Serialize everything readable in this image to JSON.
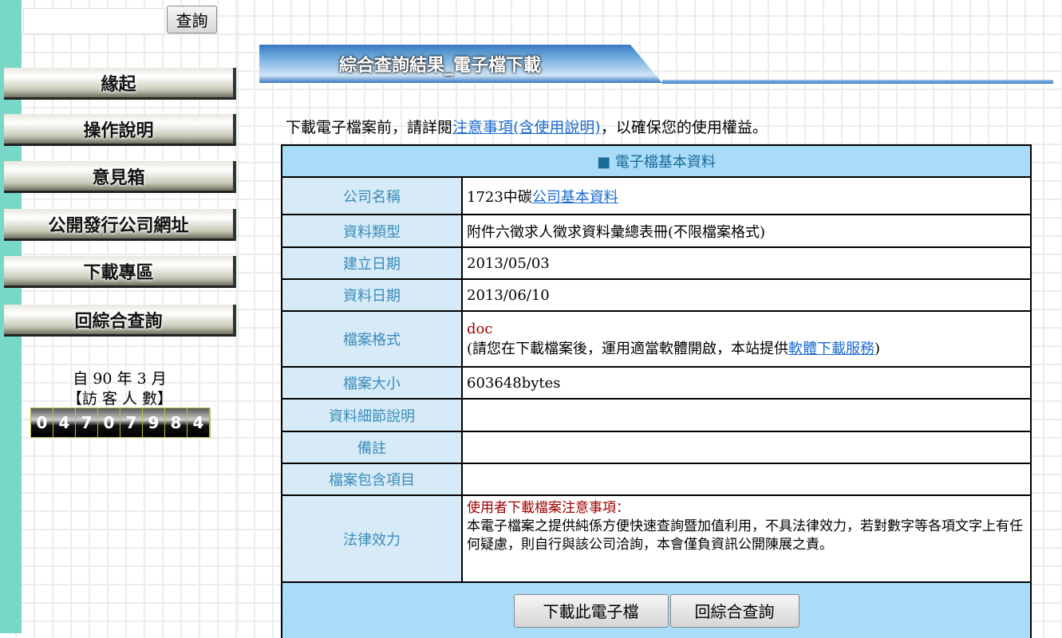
{
  "sidebar": {
    "search_button": "查詢",
    "nav": [
      "緣起",
      "操作說明",
      "意見箱",
      "公開發行公司網址",
      "下載專區",
      "回綜合查詢"
    ],
    "since": "自 90 年 3 月",
    "visitor_label": "【訪 客 人 數】",
    "counter": [
      "0",
      "4",
      "7",
      "0",
      "7",
      "9",
      "8",
      "4"
    ]
  },
  "banner": {
    "title": "綜合查詢結果_電子檔下載"
  },
  "intro": {
    "before": "下載電子檔案前，請詳閱",
    "link": "注意事項(含使用說明)",
    "after": "，以確保您的使用權益。"
  },
  "table": {
    "header": "■ 電子檔基本資料",
    "company_label": "公司名稱",
    "company_value": "1723中碳",
    "company_link": "公司基本資料",
    "type_label": "資料類型",
    "type_value": "附件六徵求人徵求資料彙總表冊(不限檔案格式)",
    "created_label": "建立日期",
    "created_value": "2013/05/03",
    "date_label": "資料日期",
    "date_value": "2013/06/10",
    "format_label": "檔案格式",
    "format_value": "doc",
    "format_note_before": "(請您在下載檔案後，運用適當軟體開啟，本站提供",
    "format_link": "軟體下載服務",
    "format_note_after": ")",
    "size_label": "檔案大小",
    "size_value": "603648bytes",
    "detail_label": "資料細節說明",
    "remark_label": "備註",
    "items_label": "檔案包含項目",
    "legal_label": "法律效力",
    "legal_title": "使用者下載檔案注意事項：",
    "legal_text": "本電子檔案之提供純係方便快速查詢暨加值利用，不具法律效力，若對數字等各項文字上有任何疑慮，則自行與該公司洽詢，本會僅負資訊公開陳展之責。"
  },
  "buttons": {
    "download": "下載此電子檔",
    "back": "回綜合查詢"
  }
}
